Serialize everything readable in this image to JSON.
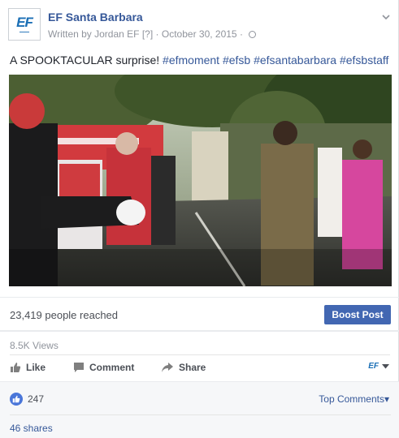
{
  "post": {
    "page_name": "EF Santa Barbara",
    "avatar_text": "EF",
    "author_prefix": "Written by Jordan EF",
    "help_mark": "[?]",
    "separator": "·",
    "date": "October 30, 2015",
    "dot": "·",
    "caption_text": "A SPOOKTACULAR surprise!",
    "caption_tags": "#efmoment #efsb #efsantabarbara #efsbstaff"
  },
  "insights": {
    "reach_text": "23,419 people reached",
    "boost_label": "Boost Post",
    "views_text": "8.5K Views"
  },
  "actions": {
    "like_label": "Like",
    "comment_label": "Comment",
    "share_label": "Share",
    "page_switch_label": "EF"
  },
  "footer": {
    "likes_count": "247",
    "top_comments_label": "Top Comments",
    "shares_text": "46 shares"
  },
  "colors": {
    "link_blue": "#365899",
    "boost_blue": "#4267b2",
    "like_blue": "#4a76d9"
  }
}
